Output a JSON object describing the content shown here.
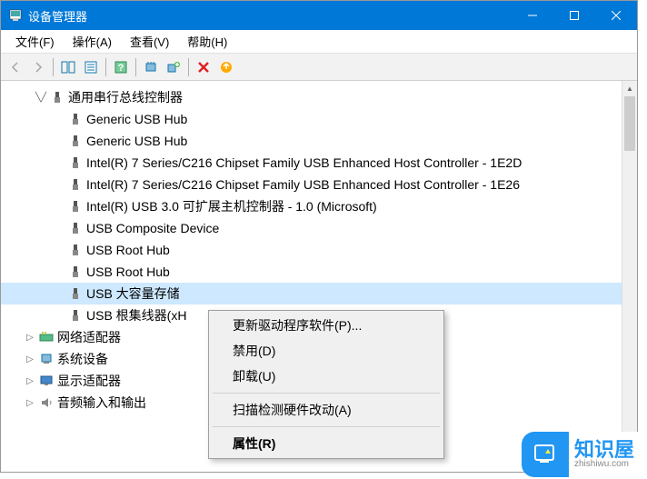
{
  "title": "设备管理器",
  "menus": {
    "file": "文件(F)",
    "action": "操作(A)",
    "view": "查看(V)",
    "help": "帮助(H)"
  },
  "tree": {
    "category_expanded": "通用串行总线控制器",
    "usb_items": [
      "Generic USB Hub",
      "Generic USB Hub",
      "Intel(R) 7 Series/C216 Chipset Family USB Enhanced Host Controller - 1E2D",
      "Intel(R) 7 Series/C216 Chipset Family USB Enhanced Host Controller - 1E26",
      "Intel(R) USB 3.0 可扩展主机控制器 - 1.0 (Microsoft)",
      "USB Composite Device",
      "USB Root Hub",
      "USB Root Hub",
      "USB 大容量存储",
      "USB 根集线器(xH"
    ],
    "selected_index": 8,
    "categories_collapsed": [
      "网络适配器",
      "系统设备",
      "显示适配器",
      "音频输入和输出"
    ]
  },
  "context_menu": {
    "update": "更新驱动程序软件(P)...",
    "disable": "禁用(D)",
    "uninstall": "卸载(U)",
    "scan": "扫描检测硬件改动(A)",
    "properties": "属性(R)"
  },
  "watermark": {
    "brand": "知识屋",
    "url": "zhishiwu.com"
  }
}
